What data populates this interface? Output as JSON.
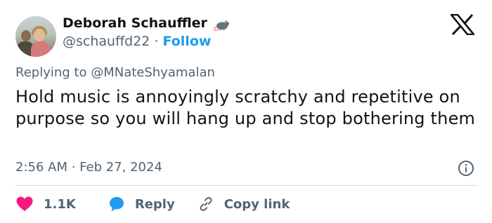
{
  "author": {
    "name": "Deborah Schauffler",
    "handle": "@schauffd22",
    "separator": " · ",
    "follow_label": "Follow"
  },
  "icons": {
    "author_badge": "rat-icon",
    "brand": "x-logo-icon",
    "info": "info-icon",
    "like": "heart-icon",
    "reply": "speech-bubble-icon",
    "copy": "link-icon"
  },
  "reply_context": {
    "prefix": "Replying to ",
    "mention": "@MNateShyamalan"
  },
  "tweet": {
    "text": "Hold music is annoyingly scratchy and repetitive on purpose so you will hang up and stop bothering them",
    "timestamp": "2:56 AM · Feb 27, 2024"
  },
  "actions": {
    "like_count": "1.1K",
    "reply_label": "Reply",
    "copy_label": "Copy link"
  },
  "colors": {
    "text": "#0f1419",
    "secondary": "#536471",
    "accent": "#1d9bf0",
    "like": "#f91880",
    "divider": "#cfd9de"
  }
}
